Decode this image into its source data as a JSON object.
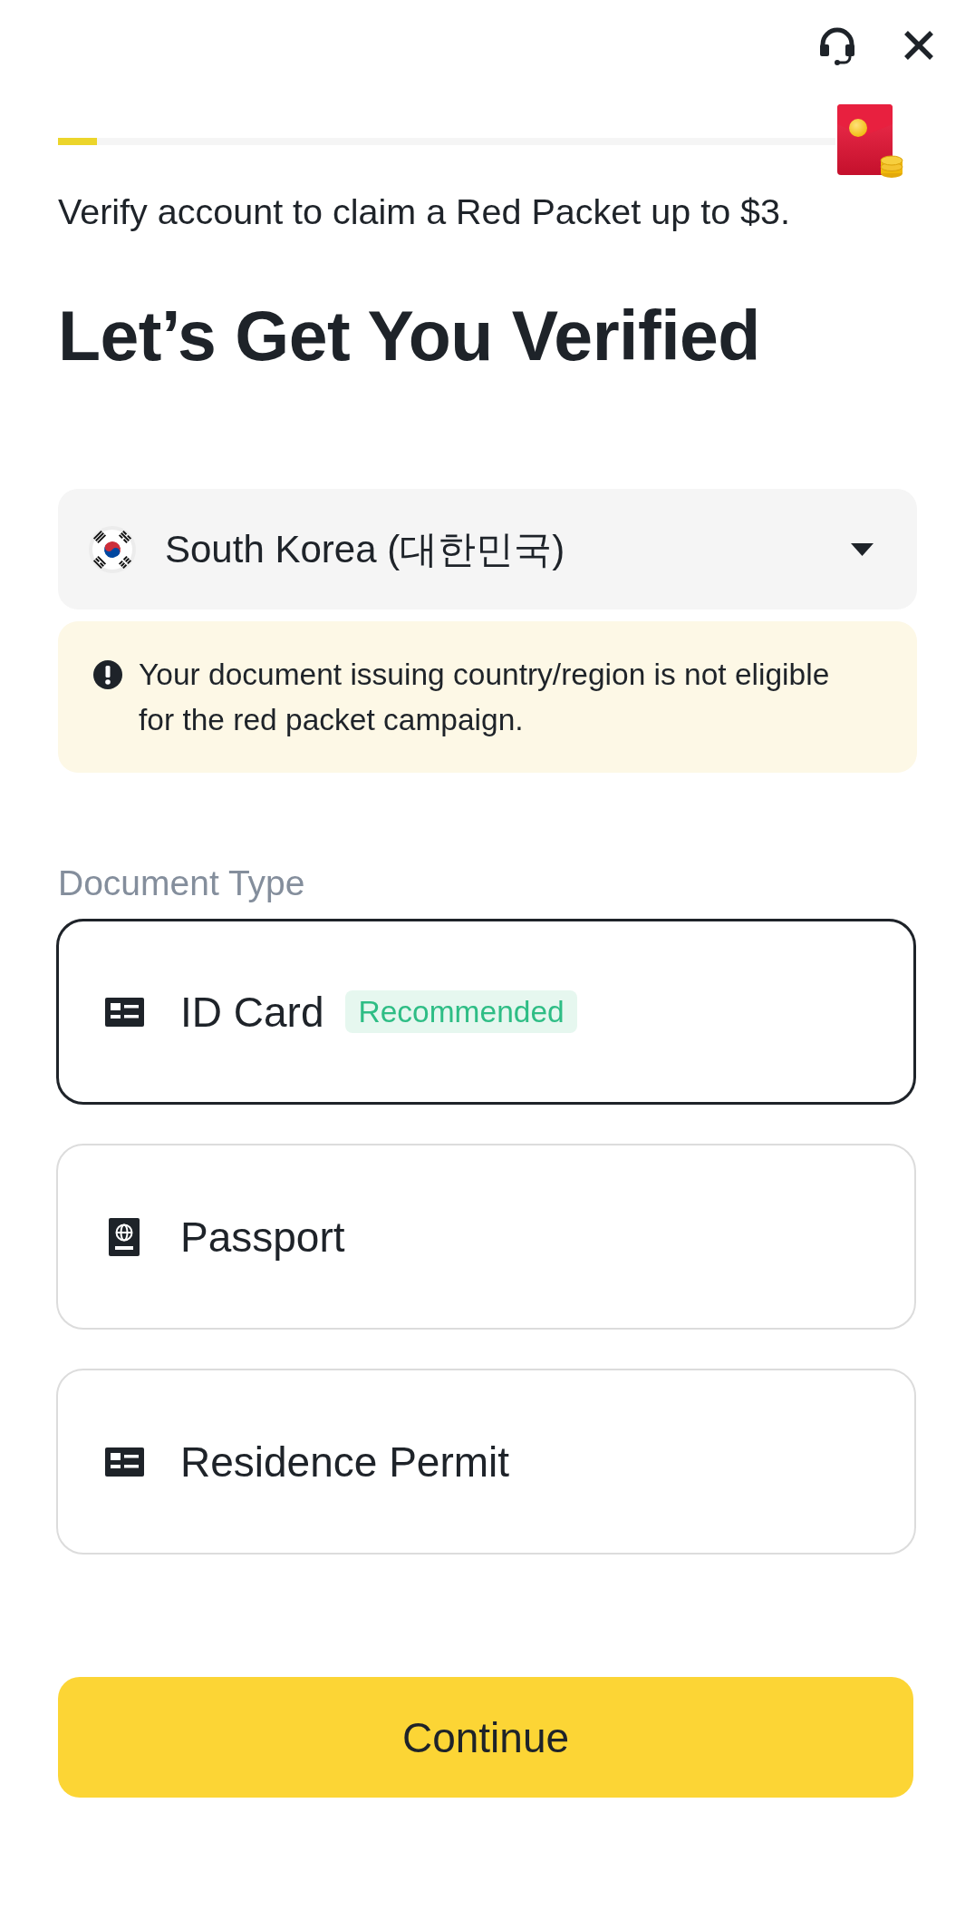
{
  "progress": {
    "level": 0.05
  },
  "promo": {
    "text": "Verify account to claim a Red Packet up to $3."
  },
  "title": "Let’s Get You Verified",
  "country_select": {
    "value": "South Korea (대한민국)"
  },
  "notice": {
    "text": "Your document issuing country/region is not eligible for the red packet campaign."
  },
  "document_type": {
    "label": "Document Type",
    "options": [
      {
        "label": "ID Card",
        "kind": "id-card",
        "badge": "Recommended",
        "selected": true
      },
      {
        "label": "Passport",
        "kind": "passport",
        "selected": false
      },
      {
        "label": "Residence Permit",
        "kind": "id-card",
        "selected": false
      }
    ]
  },
  "continue_button": {
    "label": "Continue"
  }
}
